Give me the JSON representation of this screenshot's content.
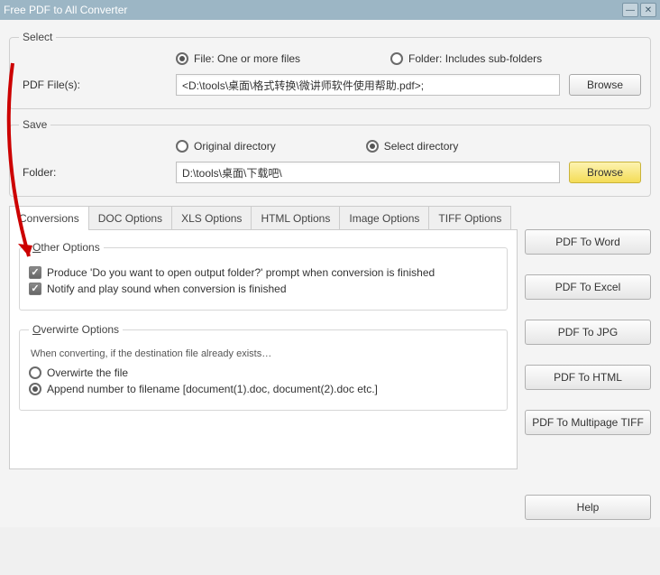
{
  "title": "Free PDF to All Converter",
  "select": {
    "legend": "Select",
    "radio_file": "File:  One or more files",
    "radio_folder": "Folder: Includes sub-folders",
    "file_label": "PDF File(s):",
    "file_value": "<D:\\tools\\桌面\\格式转换\\微讲师软件使用帮助.pdf>;",
    "browse": "Browse"
  },
  "save": {
    "legend": "Save",
    "radio_original": "Original directory",
    "radio_select": "Select directory",
    "folder_label": "Folder:",
    "folder_value": "D:\\tools\\桌面\\下载吧\\",
    "browse": "Browse"
  },
  "tabs": [
    "Conversions",
    "DOC Options",
    "XLS Options",
    "HTML Options",
    "Image Options",
    "TIFF Options"
  ],
  "other_options": {
    "legend": "Other Options",
    "legend_u": "O",
    "opt1": "Produce 'Do you want to open output folder?' prompt when conversion is finished",
    "opt2": "Notify and play sound when conversion is finished"
  },
  "overwrite": {
    "legend": "Overwirte Options",
    "legend_u": "O",
    "hint": "When converting, if the destination file already exists…",
    "r1": "Overwirte the file",
    "r2": "Append number to filename  [document(1).doc, document(2).doc etc.]"
  },
  "buttons": {
    "word": "PDF To Word",
    "excel": "PDF To Excel",
    "jpg": "PDF To JPG",
    "html": "PDF To HTML",
    "tiff": "PDF To Multipage TIFF",
    "help": "Help"
  }
}
